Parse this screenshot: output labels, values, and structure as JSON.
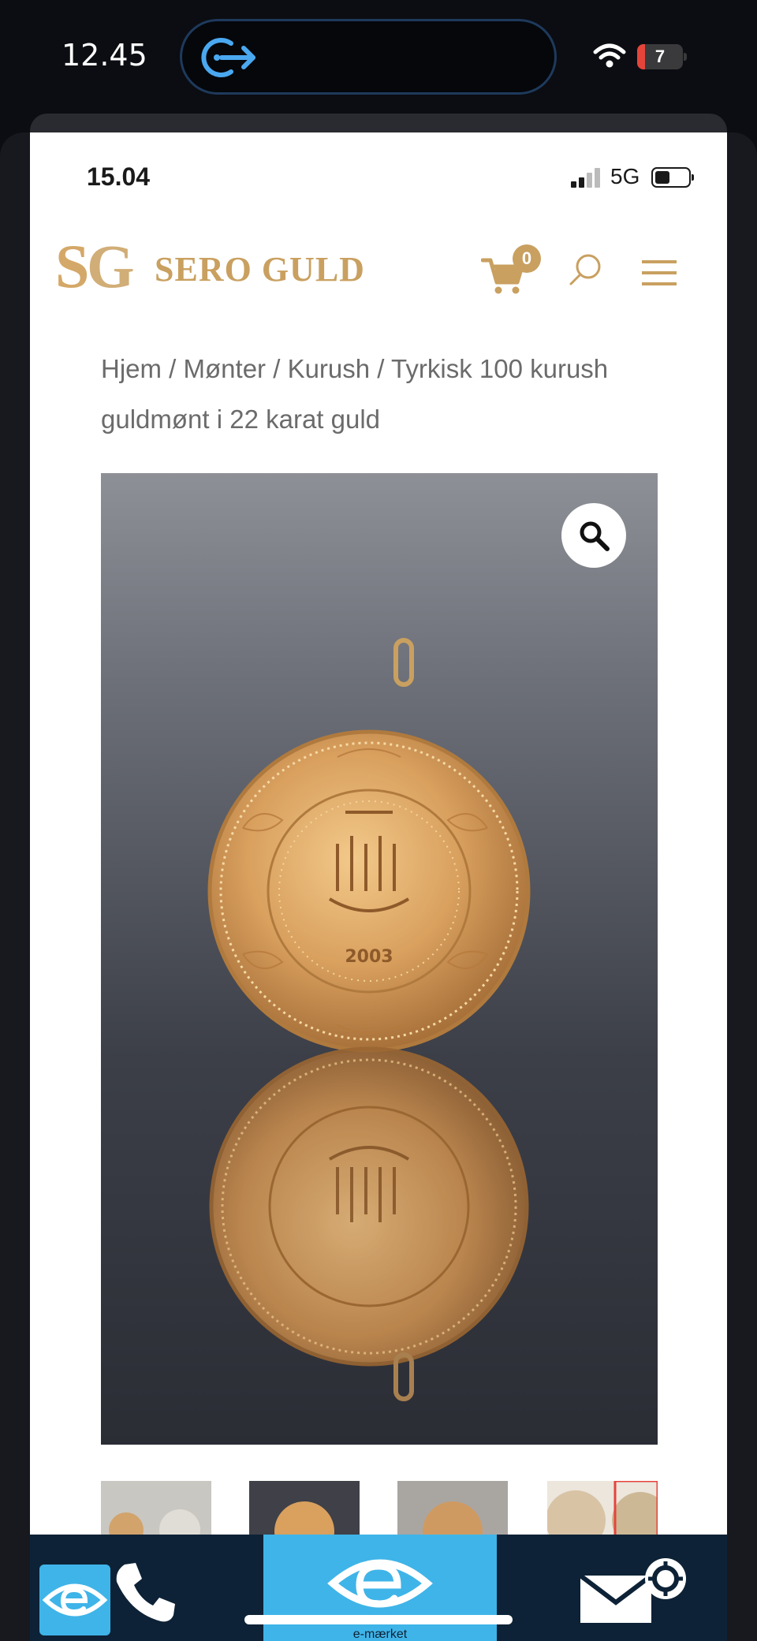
{
  "outer_status": {
    "time": "12.45",
    "battery_level": "7"
  },
  "inner_status": {
    "time": "15.04",
    "network": "5G"
  },
  "header": {
    "logo_text": "SERO GULD",
    "cart_count": "0",
    "icons": [
      "logo-mark",
      "cart-icon",
      "search-icon",
      "hamburger-menu-icon"
    ]
  },
  "breadcrumb": {
    "items": [
      "Hjem",
      "Mønter",
      "Kurush"
    ],
    "separator": " / ",
    "current": "Tyrkisk 100 kurush guldmønt i 22 karat guld"
  },
  "product": {
    "coin_year": "2003"
  },
  "toolbar": {
    "center_label": "e-mærket",
    "icons": [
      "e-mark-icon",
      "phone-icon",
      "e-mark-large-icon",
      "mail-settings-icon"
    ]
  },
  "colors": {
    "brand_gold": "#c9a060",
    "toolbar_bg": "#0d2236",
    "toolbar_accent": "#3fb4e8"
  }
}
